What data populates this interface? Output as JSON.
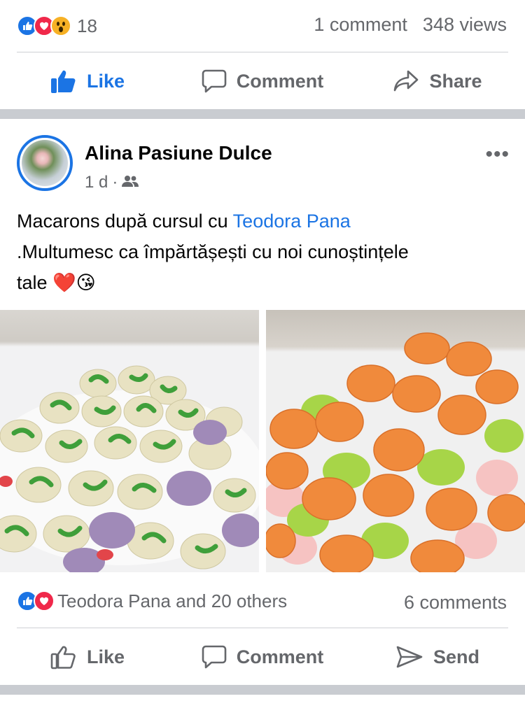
{
  "top_stats": {
    "reaction_count": "18",
    "comments": "1 comment",
    "views": "348 views"
  },
  "top_actions": {
    "like": "Like",
    "comment": "Comment",
    "share": "Share"
  },
  "post": {
    "author": "Alina Pasiune Dulce",
    "time": "1 d",
    "separator_dot": "·",
    "more": "•••",
    "text_part1": "Macarons după cursul cu ",
    "mention": "Teodora Pana",
    "text_part2": " .Multumesc ca împărtășești cu noi cunoștințele tale ",
    "emojis": "❤️😘"
  },
  "bottom_stats": {
    "reactions_text": "Teodora Pana and 20 others",
    "comments": "6 comments"
  },
  "bottom_actions": {
    "like": "Like",
    "comment": "Comment",
    "send": "Send"
  },
  "colors": {
    "accent": "#1b74e4",
    "love": "#f0284a",
    "wow": "#f7b125",
    "secondary_text": "#65676b"
  },
  "icons": [
    "like-icon",
    "love-icon",
    "wow-icon",
    "thumb-up-icon",
    "comment-bubble-icon",
    "share-arrow-icon",
    "friends-icon",
    "send-icon"
  ]
}
